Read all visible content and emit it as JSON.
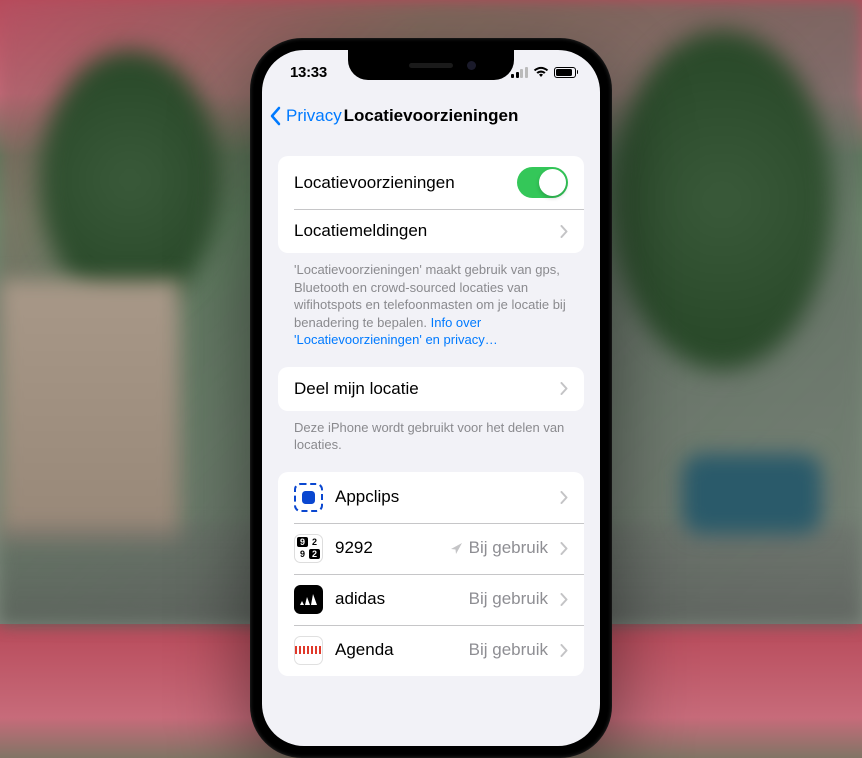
{
  "status": {
    "time": "13:33"
  },
  "nav": {
    "back_label": "Privacy",
    "title": "Locatievoorzieningen"
  },
  "section1": {
    "location_services_label": "Locatievoorzieningen",
    "location_services_on": true,
    "location_alerts_label": "Locatiemeldingen",
    "footer_text": "'Locatievoorzieningen' maakt gebruik van gps, Bluetooth en crowd-sourced locaties van wifihotspots en telefoonmasten om je locatie bij benadering te bepalen. ",
    "footer_link": "Info over 'Locatievoorzieningen' en privacy…"
  },
  "section2": {
    "share_location_label": "Deel mijn locatie",
    "footer": "Deze iPhone wordt gebruikt voor het delen van locaties."
  },
  "apps": [
    {
      "name": "Appclips",
      "detail": "",
      "show_arrow": false,
      "icon": "appclips"
    },
    {
      "name": "9292",
      "detail": "Bij gebruik",
      "show_arrow": true,
      "icon": "9292"
    },
    {
      "name": "adidas",
      "detail": "Bij gebruik",
      "show_arrow": false,
      "icon": "adidas"
    },
    {
      "name": "Agenda",
      "detail": "Bij gebruik",
      "show_arrow": false,
      "icon": "agenda"
    }
  ]
}
